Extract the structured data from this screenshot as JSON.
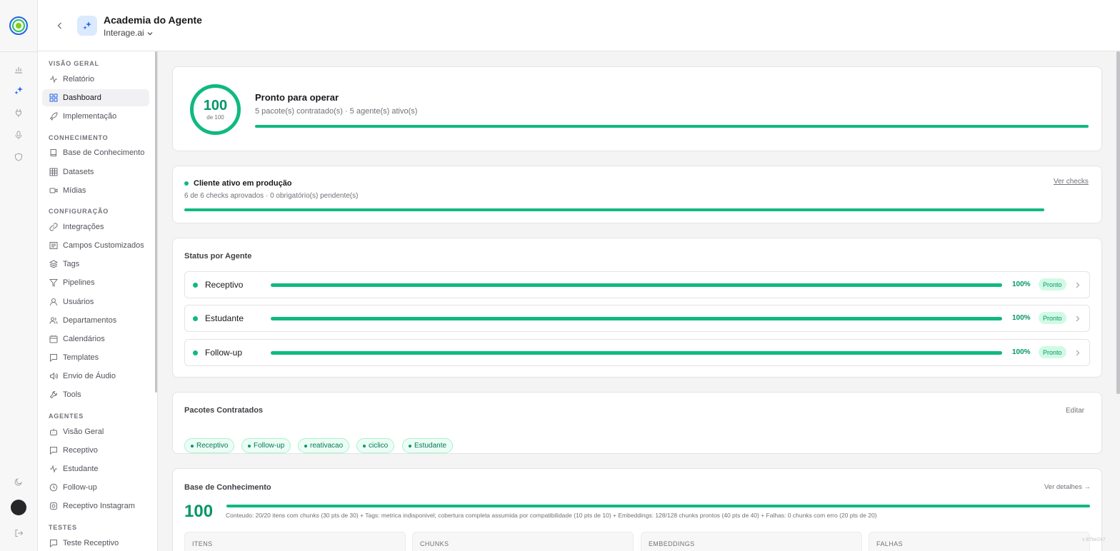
{
  "header": {
    "title": "Academia do Agente",
    "workspace": "Interage.ai"
  },
  "nav": {
    "sections": {
      "overview": "VISÃO GERAL",
      "knowledge": "CONHECIMENTO",
      "config": "CONFIGURAÇÃO",
      "agents": "AGENTES",
      "tests": "TESTES"
    },
    "items": {
      "relatorio": "Relatório",
      "dashboard": "Dashboard",
      "implementacao": "Implementação",
      "base": "Base de Conhecimento",
      "datasets": "Datasets",
      "midias": "Mídias",
      "integracoes": "Integrações",
      "campos": "Campos Customizados",
      "tags": "Tags",
      "pipelines": "Pipelines",
      "usuarios": "Usuários",
      "departamentos": "Departamentos",
      "calendarios": "Calendários",
      "templates": "Templates",
      "audio": "Envio de Áudio",
      "tools": "Tools",
      "visao_geral_agentes": "Visão Geral",
      "receptivo": "Receptivo",
      "estudante": "Estudante",
      "followup": "Follow-up",
      "receptivo_instagram": "Receptivo Instagram",
      "teste_receptivo": "Teste Receptivo"
    }
  },
  "readiness": {
    "score": "100",
    "score_of": "de 100",
    "score_value": 100,
    "title": "Pronto para operar",
    "subtitle": "5 pacote(s) contratado(s) · 5 agente(s) ativo(s)"
  },
  "production": {
    "title": "Cliente ativo em produção",
    "subtitle": "6 de 6 checks aprovados · 0 obrigatório(s) pendente(s)",
    "link": "Ver checks",
    "progress": 100
  },
  "agent_status": {
    "title": "Status por Agente",
    "agents": [
      {
        "name": "Receptivo",
        "pct": "100%",
        "badge": "Pronto",
        "progress": 100
      },
      {
        "name": "Estudante",
        "pct": "100%",
        "badge": "Pronto",
        "progress": 100
      },
      {
        "name": "Follow-up",
        "pct": "100%",
        "badge": "Pronto",
        "progress": 100
      }
    ]
  },
  "packages": {
    "title": "Pacotes Contratados",
    "edit": "Editar",
    "items": [
      "Receptivo",
      "Follow-up",
      "reativacao",
      "ciclico",
      "Estudante"
    ]
  },
  "knowledge_base": {
    "title": "Base de Conhecimento",
    "link": "Ver detalhes →",
    "score": "100",
    "description": "Conteudo: 20/20 itens com chunks (30 pts de 30) + Tags: metrica indisponivel; cobertura completa assumida por compatibilidade (10 pts de 10) + Embeddings: 128/128 chunks prontos (40 pts de 40) + Falhas: 0 chunks com erro (20 pts de 20)",
    "stats": [
      "ITENS",
      "CHUNKS",
      "EMBEDDINGS",
      "FALHAS"
    ]
  },
  "version": "v 87be247",
  "colors": {
    "accent": "#10b981",
    "accent_text": "#059669",
    "brand": "#2563eb"
  }
}
